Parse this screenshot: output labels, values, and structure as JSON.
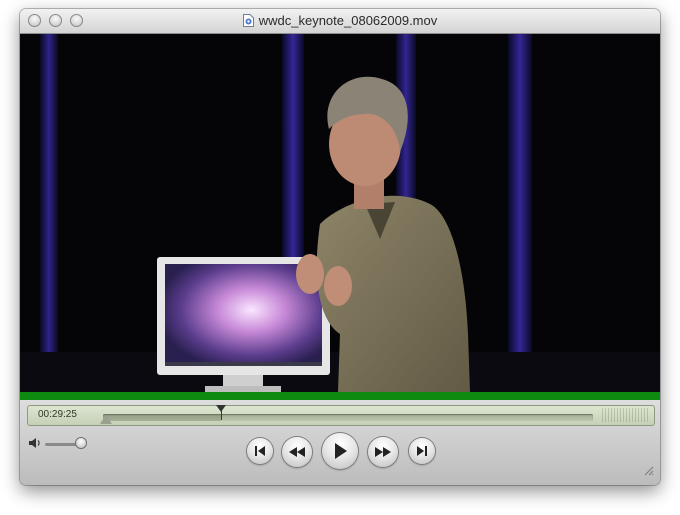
{
  "window": {
    "title": "wwdc_keynote_08062009.mov"
  },
  "player": {
    "current_time": "00:29:25",
    "playhead_fraction": 0.24,
    "volume_fraction": 0.9
  },
  "controls": {
    "buttons": [
      {
        "name": "go-to-start",
        "icon": "skip-back-icon"
      },
      {
        "name": "rewind",
        "icon": "rewind-icon"
      },
      {
        "name": "play",
        "icon": "play-icon"
      },
      {
        "name": "fast-forward",
        "icon": "fast-forward-icon"
      },
      {
        "name": "go-to-end",
        "icon": "skip-forward-icon"
      }
    ]
  },
  "colors": {
    "green_bar": "#0f8a10",
    "lcd_background": "#d4ddc6"
  }
}
